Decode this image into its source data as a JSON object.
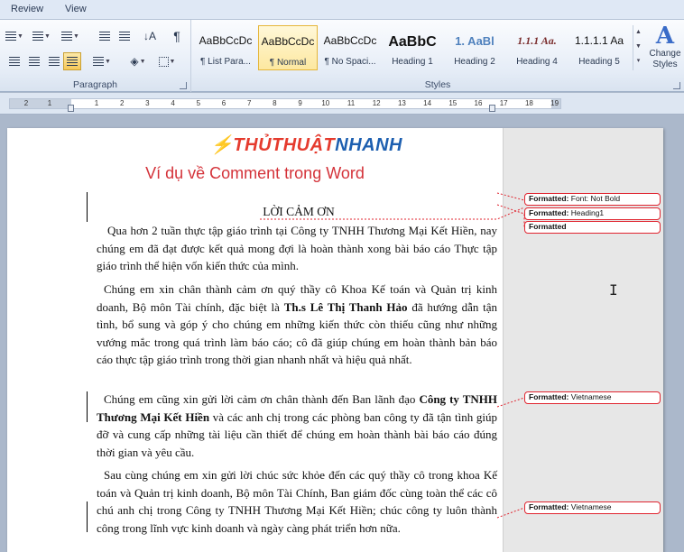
{
  "tabs": {
    "review": "Review",
    "view": "View"
  },
  "ribbon": {
    "paragraph_label": "Paragraph",
    "styles_label": "Styles",
    "pilcrow_glyph": "¶",
    "styles": [
      {
        "preview": "AaBbCcDc",
        "name": "¶ List Para...",
        "selected": false
      },
      {
        "preview": "AaBbCcDc",
        "name": "¶ Normal",
        "selected": true
      },
      {
        "preview": "AaBbCcDc",
        "name": "¶ No Spaci...",
        "selected": false
      },
      {
        "preview": "AaBbC",
        "name": "Heading 1",
        "selected": false
      },
      {
        "preview": "1. AaBl",
        "name": "Heading 2",
        "selected": false
      },
      {
        "preview": "1.1.1 Aa.",
        "name": "Heading 4",
        "selected": false
      },
      {
        "preview": "1.1.1.1 Aa",
        "name": "Heading 5",
        "selected": false
      }
    ],
    "change_styles": {
      "line1": "Change",
      "line2": "Styles"
    }
  },
  "ruler": {
    "numbers": [
      "2",
      "1",
      "1",
      "2",
      "3",
      "4",
      "5",
      "6",
      "7",
      "8",
      "9",
      "10",
      "11",
      "12",
      "13",
      "14",
      "15",
      "16",
      "17",
      "18",
      "19"
    ]
  },
  "document": {
    "logo": {
      "a": "THỦTHUẬT",
      "b": "NHANH"
    },
    "caption": "Ví dụ về Comment trong Word",
    "title": "LỜI CẢM ƠN",
    "p1": "Qua hơn 2 tuần thực tập giáo trình tại Công ty TNHH Thương Mại Kết Hiền, nay chúng em đã đạt được kết quả mong đợi là hoàn thành xong bài báo cáo Thực tập giáo trình thể hiện vốn kiến thức của mình.",
    "p2_a": "Chúng em xin chân thành cảm ơn quý thầy cô Khoa Kế toán và Quản trị kinh doanh, Bộ môn Tài chính, đặc biệt là ",
    "p2_b": "Th.s Lê Thị Thanh Hảo",
    "p2_c": " đã hướng dẫn tận tình, bổ sung và góp ý cho chúng em những kiến thức còn thiếu cũng như những vướng mắc trong quá trình làm báo cáo; cô đã giúp chúng em hoàn thành bản báo cáo thực tập giáo trình trong thời gian nhanh nhất và hiệu quả nhất.",
    "p3_a": "Chúng em cũng xin gửi lời cảm ơn chân thành đến Ban lãnh đạo ",
    "p3_b": "Công ty TNHH Thương Mại Kết Hiền",
    "p3_c": " và các anh chị trong các phòng ban công ty đã tận tình giúp đỡ và cung cấp những tài liệu cần thiết để chúng em hoàn thành bài báo cáo đúng thời gian và yêu cầu.",
    "p4": "Sau cùng chúng em xin gửi lời chúc sức khỏe đến các quý thầy cô trong khoa Kế toán và Quản trị kinh doanh, Bộ môn Tài Chính, Ban giám đốc cùng toàn thể các cô chú anh chị trong Công ty TNHH Thương Mại Kết Hiền; chúc công ty luôn thành công trong lĩnh vực kinh doanh và ngày càng phát triển hơn nữa."
  },
  "balloons": [
    {
      "label": "Formatted:",
      "detail": "Font: Not Bold"
    },
    {
      "label": "Formatted:",
      "detail": "Heading1"
    },
    {
      "label": "Formatted",
      "detail": ""
    },
    {
      "label": "Formatted:",
      "detail": "Vietnamese"
    },
    {
      "label": "Formatted:",
      "detail": "Vietnamese"
    }
  ],
  "colors": {
    "accent_red": "#e0242f",
    "caption_red": "#d4333a",
    "logo_orange": "#f6a41a",
    "logo_blue": "#1d5fb0",
    "selected_style": "#fde8a0"
  }
}
